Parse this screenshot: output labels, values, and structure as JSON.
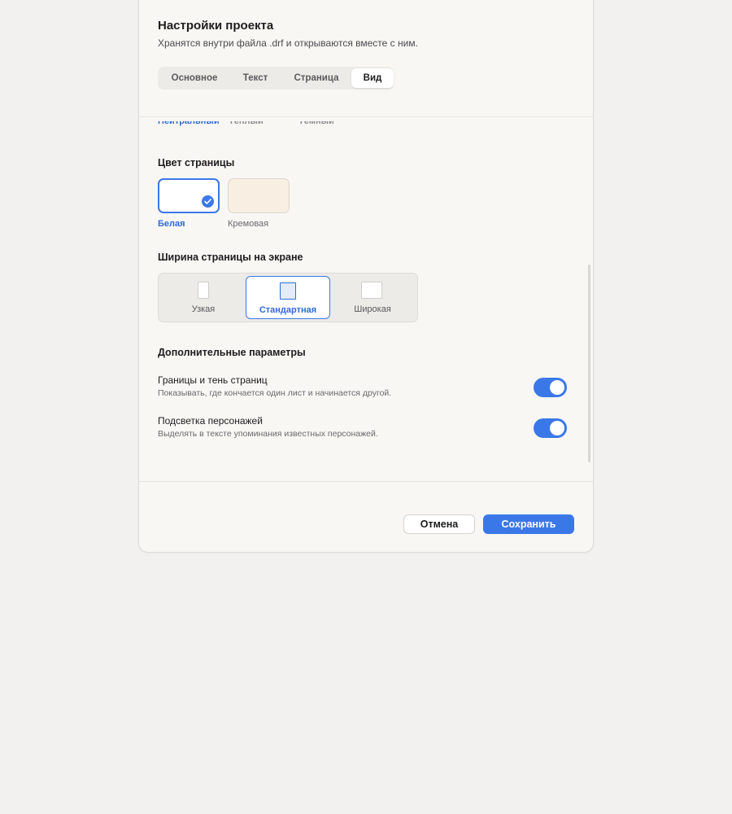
{
  "dialog": {
    "title": "Настройки проекта",
    "subtitle": "Хранятся внутри файла .drf и открываются вместе с ним."
  },
  "tabs": [
    {
      "label": "Основное",
      "active": false
    },
    {
      "label": "Текст",
      "active": false
    },
    {
      "label": "Страница",
      "active": false
    },
    {
      "label": "Вид",
      "active": true
    }
  ],
  "theme_row": {
    "items": [
      "Нейтральный",
      "Тёплый",
      "Тёмный"
    ],
    "selected": "Нейтральный"
  },
  "page_color": {
    "title": "Цвет страницы",
    "options": [
      {
        "label": "Белая",
        "color": "#ffffff",
        "selected": true
      },
      {
        "label": "Кремовая",
        "color": "#f8eee2",
        "selected": false
      }
    ]
  },
  "page_width": {
    "title": "Ширина страницы на экране",
    "options": [
      {
        "label": "Узкая",
        "selected": false
      },
      {
        "label": "Стандартная",
        "selected": true
      },
      {
        "label": "Широкая",
        "selected": false
      }
    ]
  },
  "extra": {
    "title": "Дополнительные параметры",
    "options": [
      {
        "title": "Границы и тень страниц",
        "description": "Показывать, где кончается один лист и начинается другой.",
        "enabled": true
      },
      {
        "title": "Подсветка персонажей",
        "description": "Выделять в тексте упоминания известных персонажей.",
        "enabled": true
      }
    ]
  },
  "footer": {
    "cancel_label": "Отмена",
    "save_label": "Сохранить"
  },
  "colors": {
    "accent": "#3b78e7",
    "background": "#f2f1ef",
    "dialog": "#f8f7f4"
  }
}
